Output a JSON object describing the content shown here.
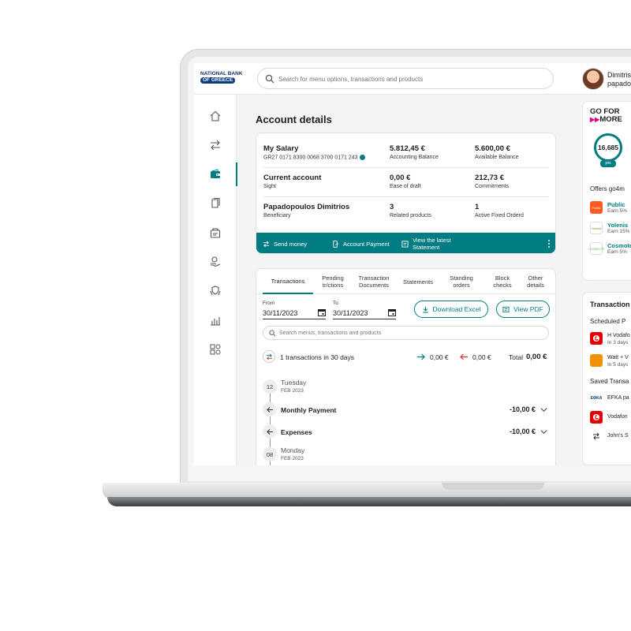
{
  "brand": {
    "line1": "NATIONAL BANK",
    "line2": "OF GREECE"
  },
  "search": {
    "placeholder": "Search for menu options, transactions and products"
  },
  "user": {
    "name": "Dimitris",
    "sub": "papado"
  },
  "page_title": "Account details",
  "account": {
    "rows": [
      {
        "title": "My Salary",
        "iban": "GR27 0171 8300 0068 3700 0171 243",
        "v1": "5.812,45 €",
        "v1_label": "Accounting Balance",
        "v2": "5.600,00 €",
        "v2_label": "Available Balance"
      },
      {
        "title": "Current account",
        "subtitle": "Sight",
        "v1": "0,00 €",
        "v1_label": "Ease of draft",
        "v2": "212,73 €",
        "v2_label": "Commitments"
      },
      {
        "title": "Papadopoulos Dimitrios",
        "subtitle": "Beneficiary",
        "v1": "3",
        "v1_label": "Related products",
        "v2": "1",
        "v2_label": "Active Fixed Orderd"
      }
    ],
    "actions": {
      "send_money": "Send money",
      "account_payment": "Account Payment",
      "view_statement": "View the latest Statement"
    }
  },
  "transactions": {
    "tabs": [
      "Transactions",
      "Pending tr/ctions",
      "Transaction Documents",
      "Statements",
      "Standing orders",
      "Block checks",
      "Other details"
    ],
    "from_label": "From",
    "from_value": "30/11/2023",
    "to_label": "To",
    "to_value": "30/11/2023",
    "download_excel": "Download Excel",
    "view_pdf": "View PDF",
    "search_placeholder": "Search menus, transactions and products",
    "summary_text": "1 transactions in 30 days",
    "in_amount": "0,00 €",
    "out_amount": "0,00 €",
    "total_label": "Total",
    "total_value": "0,00 €",
    "days": [
      {
        "day": "12",
        "name": "Tuesday",
        "date": "FEB 2023"
      },
      {
        "day": "08",
        "name": "Monday",
        "date": "FEB 2023"
      }
    ],
    "items": [
      {
        "name": "Monthly Payment",
        "amount": "-10,00 €"
      },
      {
        "name": "Expenses",
        "amount": "-10,00 €"
      }
    ]
  },
  "go4more": {
    "logo_line1": "GO FOR",
    "logo_line2": "MORE",
    "points": "16,685",
    "pts_label": "pts",
    "offers_title": "Offers go4m",
    "offers": [
      {
        "name": "Public",
        "sub": "Earn 5%",
        "logo": "Public",
        "color": "#ff5a1f"
      },
      {
        "name": "Yolenis",
        "sub": "Earn 15%",
        "logo": "Yolenis",
        "color": "#ffffff"
      },
      {
        "name": "Cosmote",
        "sub": "Earn 5%",
        "logo": "COSMOTE",
        "color": "#ffffff"
      }
    ]
  },
  "transfers": {
    "title": "Transaction",
    "scheduled_title": "Scheduled P",
    "scheduled": [
      {
        "name": "H Vodafo",
        "sub": "In 3 days",
        "color": "#e60000"
      },
      {
        "name": "Watt + V",
        "sub": "In 5 days",
        "color": "#f39200"
      }
    ],
    "saved_title": "Saved Transa",
    "saved": [
      {
        "name": "EFKA pa",
        "logo": "ΕΦΚΑ",
        "color": "#ffffff"
      },
      {
        "name": "Vodafon",
        "logo": "",
        "color": "#e60000"
      },
      {
        "name": "John's S",
        "logo": "",
        "color": "#ffffff"
      }
    ]
  },
  "colors": {
    "accent": "#007c83",
    "brand_blue": "#0a3c7c"
  }
}
